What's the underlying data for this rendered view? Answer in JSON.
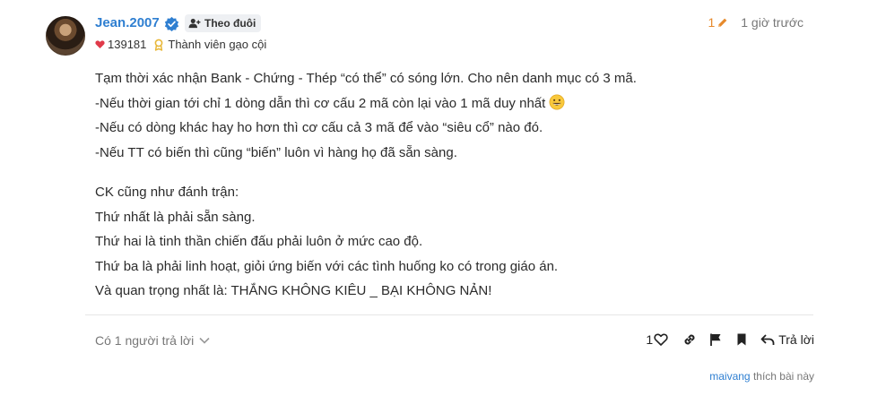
{
  "author": {
    "name": "Jean.2007",
    "follow_label": "Theo đuôi",
    "likes": "139181",
    "rank": "Thành viên gạo cội"
  },
  "meta": {
    "edit_count": "1",
    "time": "1 giờ trước"
  },
  "content": {
    "lines": [
      "Tạm thời xác nhận Bank - Chứng - Thép “có thể” có sóng lớn. Cho nên danh mục có 3 mã.",
      "-Nếu thời gian tới chỉ 1 dòng dẫn thì cơ cấu 2 mã còn lại vào 1 mã duy nhất",
      "-Nếu có dòng khác hay ho hơn thì cơ cấu cả 3 mã để vào “siêu cổ” nào đó.",
      "-Nếu TT có biến thì cũng “biến” luôn vì hàng họ đã sẵn sàng.",
      "CK cũng như đánh trận:",
      "Thứ nhất là phải sẵn sàng.",
      "Thứ hai là tinh thần chiến đấu phải luôn ở mức cao độ.",
      "Thứ ba là phải linh hoạt, giỏi ứng biến với các tình huống ko có trong giáo án.",
      "Và quan trọng nhất là: THẮNG KHÔNG KIÊU _ BẠI KHÔNG NẢN!"
    ]
  },
  "footer": {
    "replies_label": "Có 1 người trả lời",
    "like_count": "1",
    "reply_label": "Trả lời",
    "liked_by_user": "maivang",
    "liked_by_suffix": " thích bài này"
  },
  "icons": {
    "verified": "verified-badge-icon",
    "follow": "user-plus-icon",
    "heart": "heart-icon",
    "rank": "medal-icon",
    "edit": "pencil-icon",
    "smile": "smile-emoji-icon",
    "chevron": "chevron-down-icon",
    "like": "heart-outline-icon",
    "link": "link-icon",
    "flag": "flag-icon",
    "bookmark": "bookmark-icon",
    "reply": "reply-arrow-icon"
  },
  "colors": {
    "username": "#2f7fd1",
    "edit_count": "#e6892b",
    "heart": "#e03a4a",
    "rank": "#e8b83a"
  }
}
